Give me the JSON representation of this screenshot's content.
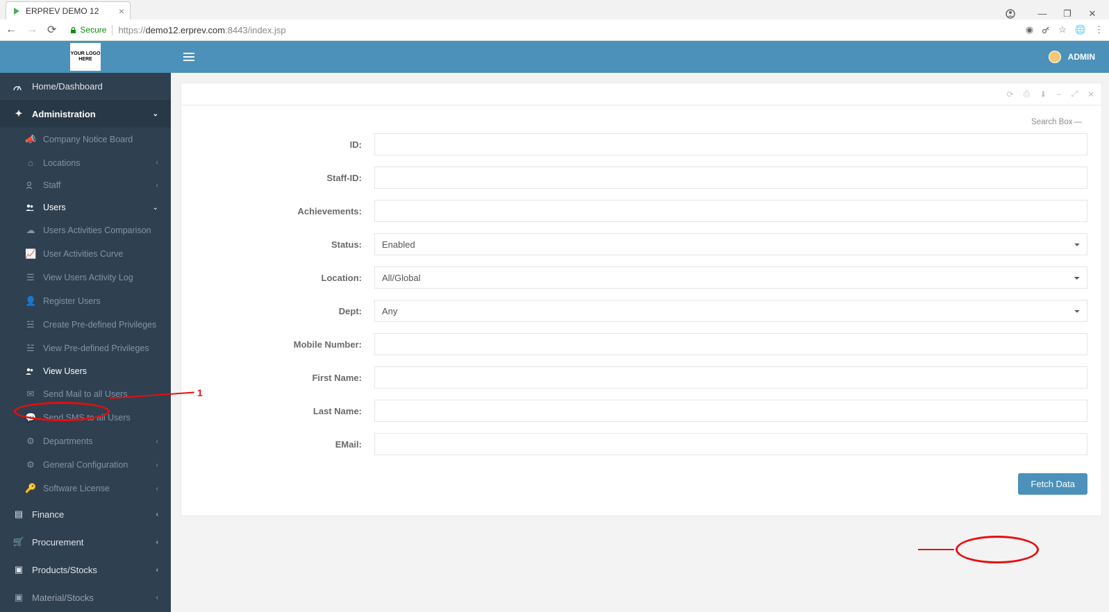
{
  "browser": {
    "tab_title": "ERPREV DEMO 12",
    "secure_label": "Secure",
    "url_scheme": "https://",
    "url_host": "demo12.erprev.com",
    "url_port_path": ":8443/index.jsp"
  },
  "header": {
    "logo_text": "YOUR LOGO HERE",
    "user_label": "ADMIN"
  },
  "sidebar": {
    "home": "Home/Dashboard",
    "administration": "Administration",
    "company_notice": "Company Notice Board",
    "locations": "Locations",
    "staff": "Staff",
    "users": "Users",
    "users_sub": {
      "activities_comparison": "Users Activities Comparison",
      "activities_curve": "User Activities Curve",
      "activity_log": "View Users Activity Log",
      "register_users": "Register Users",
      "create_privileges": "Create Pre-defined Privileges",
      "view_privileges": "View Pre-defined Privileges",
      "view_users": "View Users",
      "send_mail": "Send Mail to all Users",
      "send_sms": "Send SMS to all Users"
    },
    "departments": "Departments",
    "general_config": "General Configuration",
    "software_license": "Software License",
    "finance": "Finance",
    "procurement": "Procurement",
    "products_stocks": "Products/Stocks",
    "material_stocks": "Material/Stocks"
  },
  "panel": {
    "search_box_label": "Search Box"
  },
  "form": {
    "id_label": "ID:",
    "staff_id_label": "Staff-ID:",
    "achievements_label": "Achievements:",
    "status_label": "Status:",
    "status_value": "Enabled",
    "location_label": "Location:",
    "location_value": "All/Global",
    "dept_label": "Dept:",
    "dept_value": "Any",
    "mobile_label": "Mobile Number:",
    "first_name_label": "First Name:",
    "last_name_label": "Last Name:",
    "email_label": "EMail:",
    "fetch_button": "Fetch Data"
  },
  "annotations": {
    "marker1": "1"
  }
}
